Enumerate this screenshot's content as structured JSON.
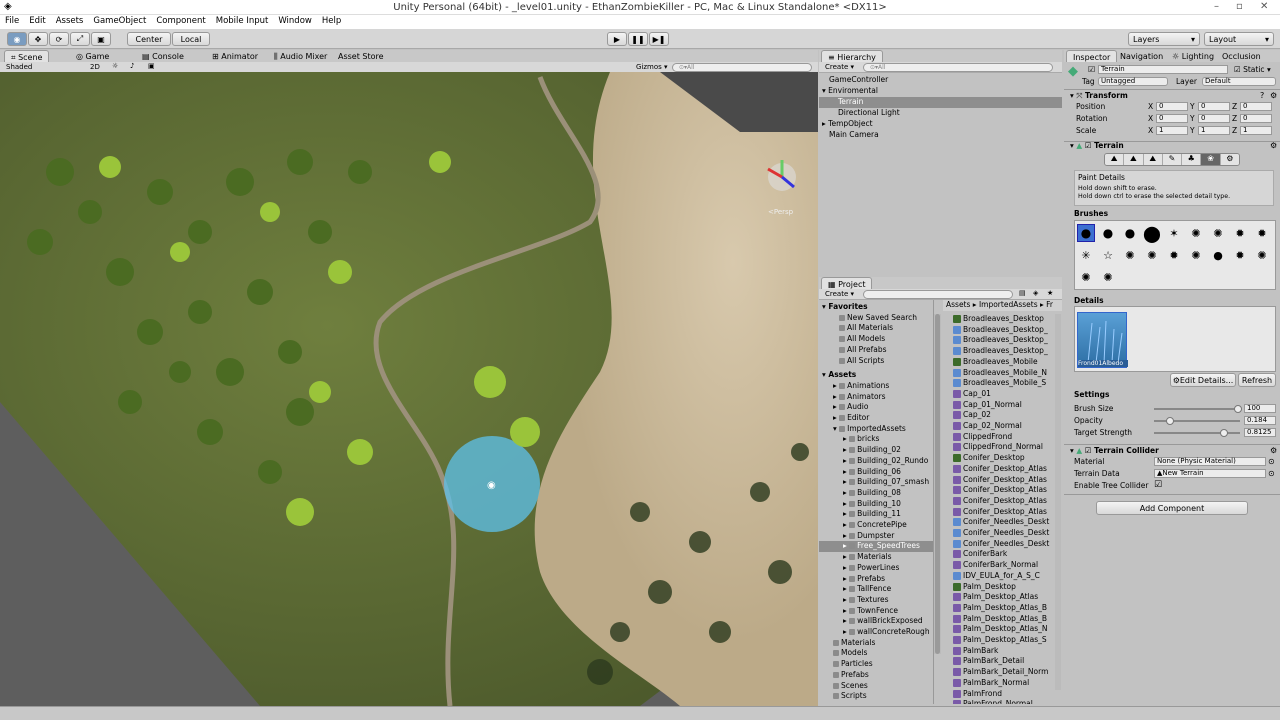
{
  "window": {
    "title": "Unity Personal (64bit) - _level01.unity - EthanZombieKiller - PC, Mac & Linux Standalone* <DX11>",
    "controls": [
      "–",
      "▫",
      "✕"
    ]
  },
  "menu": [
    "File",
    "Edit",
    "Assets",
    "GameObject",
    "Component",
    "Mobile Input",
    "Window",
    "Help"
  ],
  "toolbar": {
    "center": "Center",
    "local": "Local",
    "layers": "Layers",
    "layout": "Layout"
  },
  "scene": {
    "tabs": [
      "Scene",
      "Game",
      "Console",
      "Animator",
      "Audio Mixer",
      "Asset Store"
    ],
    "shading": "Shaded",
    "mode2d": "2D",
    "gizmos": "Gizmos ▾",
    "search": "⊙▾All",
    "persp": "<Persp"
  },
  "hierarchy": {
    "tab": "Hierarchy",
    "create": "Create ▾",
    "search": "⊙▾All",
    "items": [
      "GameController",
      "Enviromental",
      "Terrain",
      "Directional Light",
      "TempObject",
      "Main Camera"
    ]
  },
  "project": {
    "tab": "Project",
    "create": "Create ▾",
    "breadcrumb": "Assets ▸ ImportedAssets ▸ Fr",
    "favorites_label": "Favorites",
    "favorites": [
      "New Saved Search",
      "All Materials",
      "All Models",
      "All Prefabs",
      "All Scripts"
    ],
    "assets_label": "Assets",
    "tree": [
      "Animations",
      "Animators",
      "Audio",
      "Editor",
      "ImportedAssets",
      "bricks",
      "Building_02",
      "Building_02_Rundo",
      "Building_06",
      "Building_07_smash",
      "Building_08",
      "Building_10",
      "Building_11",
      "ConcretePipe",
      "Dumpster",
      "Free_SpeedTrees",
      "Materials",
      "PowerLines",
      "Prefabs",
      "TallFence",
      "Textures",
      "TownFence",
      "wallBrickExposed",
      "wallConcreteRough",
      "Materials",
      "Models",
      "Particles",
      "Prefabs",
      "Scenes",
      "Scripts"
    ],
    "files": [
      "Broadleaves_Desktop",
      "Broadleaves_Desktop_",
      "Broadleaves_Desktop_",
      "Broadleaves_Desktop_",
      "Broadleaves_Mobile",
      "Broadleaves_Mobile_N",
      "Broadleaves_Mobile_S",
      "Cap_01",
      "Cap_01_Normal",
      "Cap_02",
      "Cap_02_Normal",
      "ClippedFrond",
      "ClippedFrond_Normal",
      "Conifer_Desktop",
      "Conifer_Desktop_Atlas",
      "Conifer_Desktop_Atlas",
      "Conifer_Desktop_Atlas",
      "Conifer_Desktop_Atlas",
      "Conifer_Desktop_Atlas",
      "Conifer_Needles_Deskt",
      "Conifer_Needles_Deskt",
      "Conifer_Needles_Deskt",
      "ConiferBark",
      "ConiferBark_Normal",
      "IDV_EULA_for_A_S_C",
      "Palm_Desktop",
      "Palm_Desktop_Atlas",
      "Palm_Desktop_Atlas_B",
      "Palm_Desktop_Atlas_B",
      "Palm_Desktop_Atlas_N",
      "Palm_Desktop_Atlas_S",
      "PalmBark",
      "PalmBark_Detail",
      "PalmBark_Detail_Norm",
      "PalmBark_Normal",
      "PalmFrond",
      "PalmFrond_Normal"
    ]
  },
  "inspector": {
    "tabs": [
      "Inspector",
      "Navigation",
      "Lighting",
      "Occlusion"
    ],
    "name": "Terrain",
    "static": "Static",
    "tag_label": "Tag",
    "tag": "Untagged",
    "layer_label": "Layer",
    "layer": "Default",
    "transform": {
      "title": "Transform",
      "position_label": "Position",
      "rotation_label": "Rotation",
      "scale_label": "Scale",
      "position": [
        "0",
        "0",
        "0"
      ],
      "rotation": [
        "0",
        "0",
        "0"
      ],
      "scale": [
        "1",
        "1",
        "1"
      ]
    },
    "terrain": {
      "title": "Terrain",
      "paint_title": "Paint Details",
      "hint1": "Hold down shift to erase.",
      "hint2": "Hold down ctrl to erase the selected detail type.",
      "brushes_label": "Brushes",
      "details_label": "Details",
      "detail_name": "Frond01Albedo",
      "edit_details": "Edit Details...",
      "refresh": "Refresh",
      "settings_label": "Settings",
      "brush_size_label": "Brush Size",
      "brush_size": "100",
      "brush_size_frac": 0.98,
      "opacity_label": "Opacity",
      "opacity": "0.184",
      "opacity_frac": 0.184,
      "target_label": "Target Strength",
      "target": "0.8125",
      "target_frac": 0.8125
    },
    "collider": {
      "title": "Terrain Collider",
      "material_label": "Material",
      "material": "None (Physic Material)",
      "data_label": "Terrain Data",
      "data": "New Terrain",
      "enable_label": "Enable Tree Collider"
    },
    "add_component": "Add Component"
  }
}
